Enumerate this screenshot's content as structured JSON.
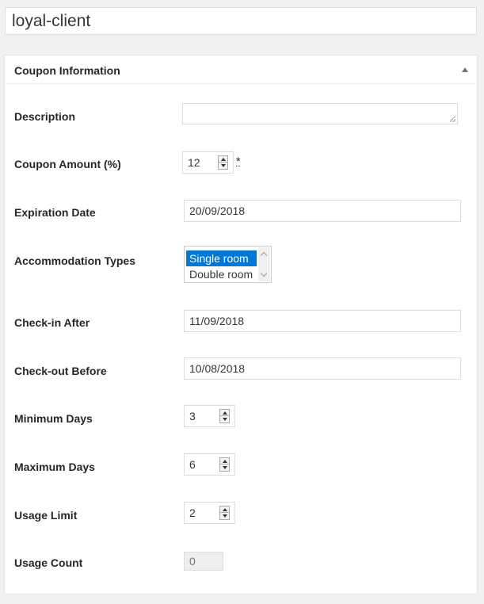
{
  "title_value": "loyal-client",
  "box": {
    "title": "Coupon Information"
  },
  "fields": {
    "description": {
      "label": "Description",
      "value": ""
    },
    "coupon_amount": {
      "label": "Coupon Amount (%)",
      "value": "12",
      "required_mark": "*"
    },
    "expiration_date": {
      "label": "Expiration Date",
      "value": "20/09/2018"
    },
    "accommodation_types": {
      "label": "Accommodation Types",
      "options": [
        "Single room",
        "Double room"
      ],
      "selected": "Single room"
    },
    "check_in_after": {
      "label": "Check-in After",
      "value": "11/09/2018"
    },
    "check_out_before": {
      "label": "Check-out Before",
      "value": "10/08/2018"
    },
    "minimum_days": {
      "label": "Minimum Days",
      "value": "3"
    },
    "maximum_days": {
      "label": "Maximum Days",
      "value": "6"
    },
    "usage_limit": {
      "label": "Usage Limit",
      "value": "2"
    },
    "usage_count": {
      "label": "Usage Count",
      "value": "0"
    }
  },
  "icons": {
    "toggle": "triangle-up-icon",
    "spinner": "spinner-arrows-icon",
    "resize": "resize-grip-icon"
  }
}
